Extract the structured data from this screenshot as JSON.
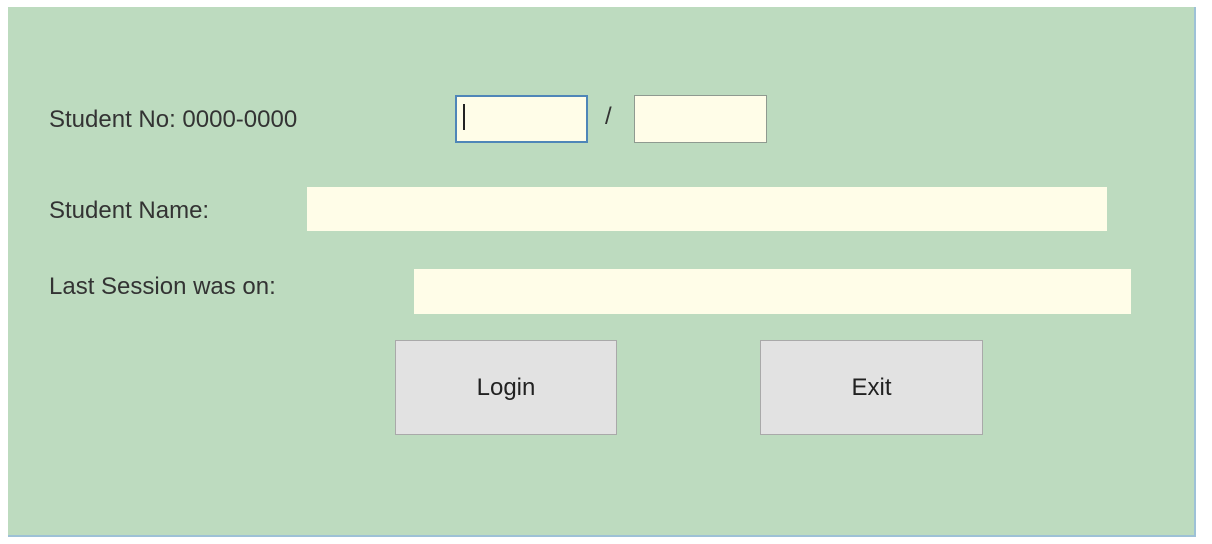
{
  "form": {
    "student_no_label": "Student No: 0000-0000",
    "student_no_part1": "",
    "separator": "/",
    "student_no_part2": "",
    "student_name_label": "Student Name:",
    "student_name_value": "",
    "last_session_label": "Last Session was on:",
    "last_session_value": ""
  },
  "buttons": {
    "login_label": "Login",
    "exit_label": "Exit"
  },
  "colors": {
    "window_background": "#bddbbf",
    "field_background": "#fffde8",
    "button_background": "#e2e2e2",
    "focus_border": "#4f86b8"
  }
}
